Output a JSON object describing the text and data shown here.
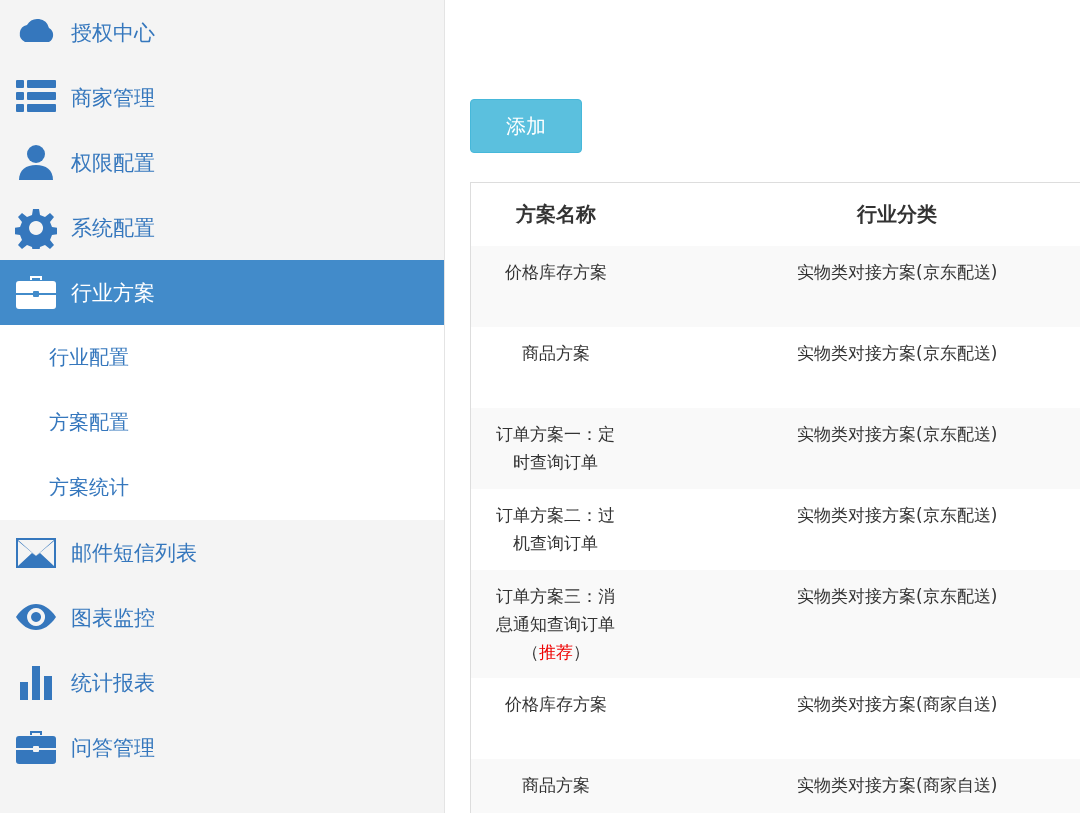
{
  "sidebar": {
    "items": [
      {
        "label": "授权中心",
        "selected": false
      },
      {
        "label": "商家管理",
        "selected": false
      },
      {
        "label": "权限配置",
        "selected": false
      },
      {
        "label": "系统配置",
        "selected": false
      },
      {
        "label": "行业方案",
        "selected": true,
        "expanded": true,
        "children": [
          {
            "label": "行业配置",
            "selected": false
          },
          {
            "label": "方案配置",
            "selected": false
          },
          {
            "label": "方案统计",
            "selected": false
          }
        ]
      },
      {
        "label": "邮件短信列表",
        "selected": false
      },
      {
        "label": "图表监控",
        "selected": false
      },
      {
        "label": "统计报表",
        "selected": false
      },
      {
        "label": "问答管理",
        "selected": false
      }
    ]
  },
  "add_button": "添加",
  "table": {
    "columns": [
      "方案名称",
      "行业分类"
    ],
    "rows": [
      {
        "name": "价格库存方案",
        "category": "实物类对接方案(京东配送)"
      },
      {
        "name": "商品方案",
        "category": "实物类对接方案(京东配送)"
      },
      {
        "name": "订单方案一：定时查询订单",
        "category": "实物类对接方案(京东配送)"
      },
      {
        "name": "订单方案二：过机查询订单",
        "category": "实物类对接方案(京东配送)"
      },
      {
        "name": "订单方案三：消息通知查询订单（",
        "highlight": "推荐",
        "name_tail": "）",
        "category": "实物类对接方案(京东配送)"
      },
      {
        "name": "价格库存方案",
        "category": "实物类对接方案(商家自送)"
      },
      {
        "name": "商品方案",
        "category": "实物类对接方案(商家自送)"
      }
    ]
  }
}
